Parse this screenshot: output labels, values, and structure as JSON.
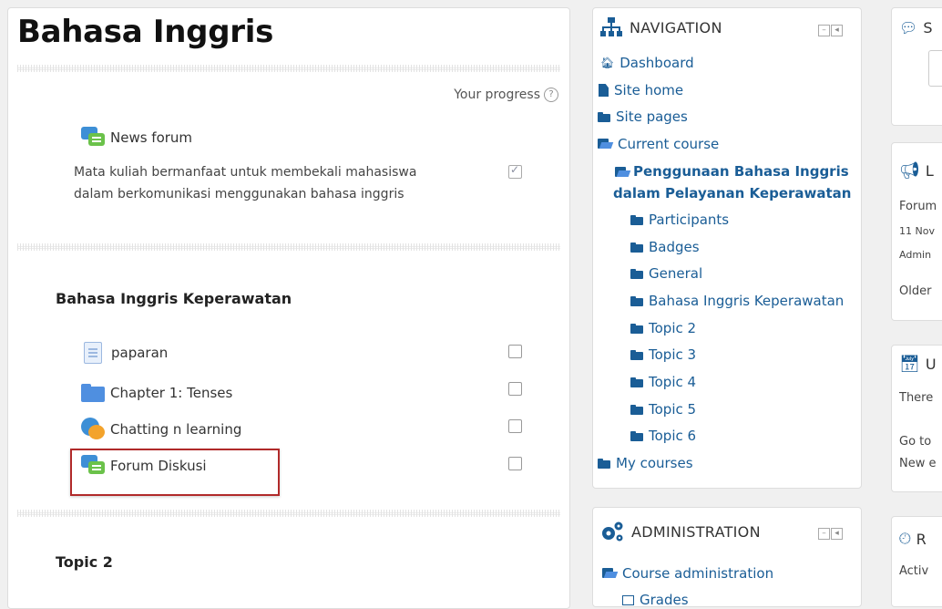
{
  "course": {
    "title": "Bahasa Inggris",
    "progress_label": "Your progress",
    "news_forum": "News forum",
    "description": "Mata kuliah bermanfaat untuk membekali mahasiswa dalam berkomunikasi menggunakan bahasa inggris",
    "section1_title": "Bahasa Inggris Keperawatan",
    "activities": [
      "paparan",
      "Chapter 1: Tenses",
      "Chatting n learning",
      "Forum Diskusi"
    ],
    "section2_title": "Topic 2"
  },
  "navigation": {
    "title": "NAVIGATION",
    "dashboard": "Dashboard",
    "site_home": "Site home",
    "site_pages": "Site pages",
    "current_course": "Current course",
    "course_name": "Penggunaan Bahasa Inggris dalam Pelayanan Keperawatan",
    "children": [
      "Participants",
      "Badges",
      "General",
      "Bahasa Inggris Keperawatan",
      "Topic 2",
      "Topic 3",
      "Topic 4",
      "Topic 5",
      "Topic 6"
    ],
    "my_courses": "My courses"
  },
  "administration": {
    "title": "ADMINISTRATION",
    "course_admin": "Course administration",
    "grades": "Grades"
  },
  "right": {
    "search_head": "S",
    "latest_head": "L",
    "latest_lines": [
      "Forum",
      "11 Nov",
      "Admin",
      "Older"
    ],
    "upcoming_head": "U",
    "upcoming_lines": [
      "There",
      "Go to",
      "New e"
    ],
    "recent_head": "R",
    "recent_line": "Activ"
  }
}
